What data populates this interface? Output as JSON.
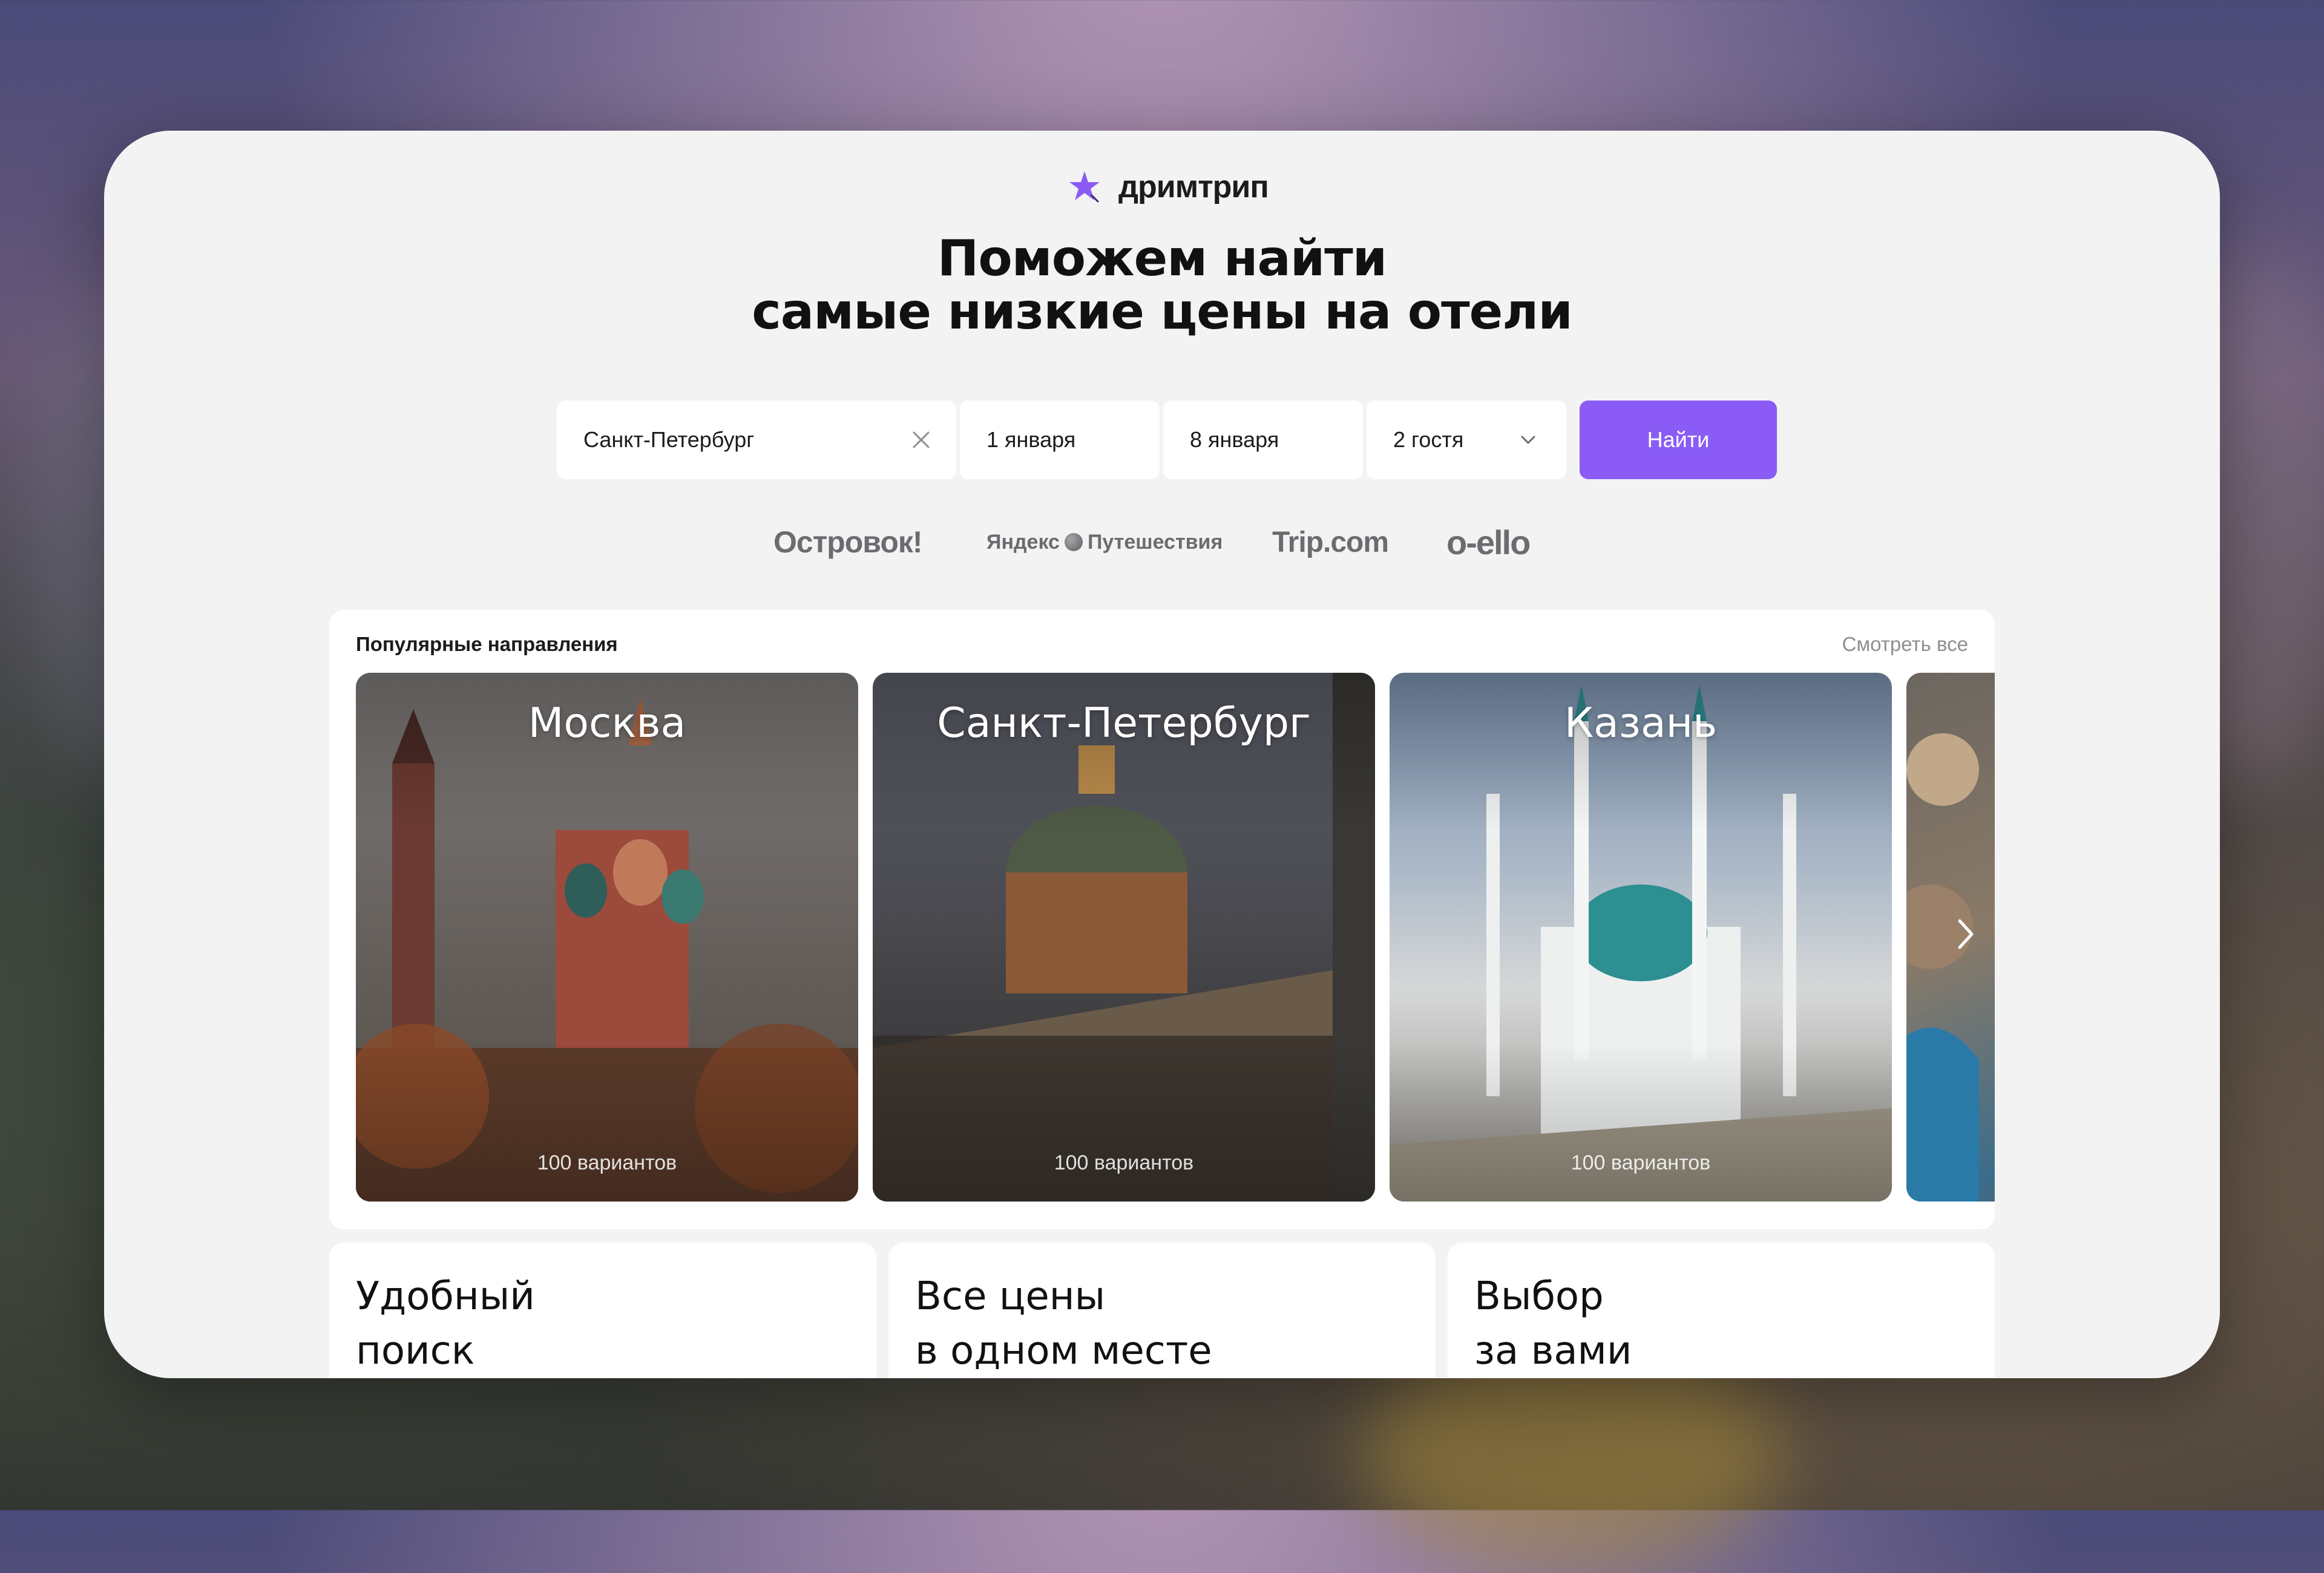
{
  "brand": {
    "name": "дримтрип",
    "accent": "#8a5cf5"
  },
  "headline": {
    "line1": "Поможем найти",
    "line2": "самые низкие цены на отели"
  },
  "search": {
    "city": "Санкт-Петербург",
    "check_in": "1 января",
    "check_out": "8 января",
    "guests": "2 гостя",
    "button_label": "Найти"
  },
  "partners": {
    "ostrovok": "Островок!",
    "yandex_left": "Яндекс",
    "yandex_right": "Путешествия",
    "trip": "Trip.com",
    "otello": "o-ello"
  },
  "popular": {
    "title": "Популярные направления",
    "see_all": "Смотреть все",
    "cards": [
      {
        "city": "Москва",
        "count": "100 вариантов"
      },
      {
        "city": "Санкт-Петербург",
        "count": "100 вариантов"
      },
      {
        "city": "Казань",
        "count": "100 вариантов"
      }
    ]
  },
  "features": [
    {
      "line1": "Удобный",
      "line2": "поиск"
    },
    {
      "line1": "Все цены",
      "line2": "в одном месте"
    },
    {
      "line1": "Выбор",
      "line2": "за вами"
    }
  ]
}
